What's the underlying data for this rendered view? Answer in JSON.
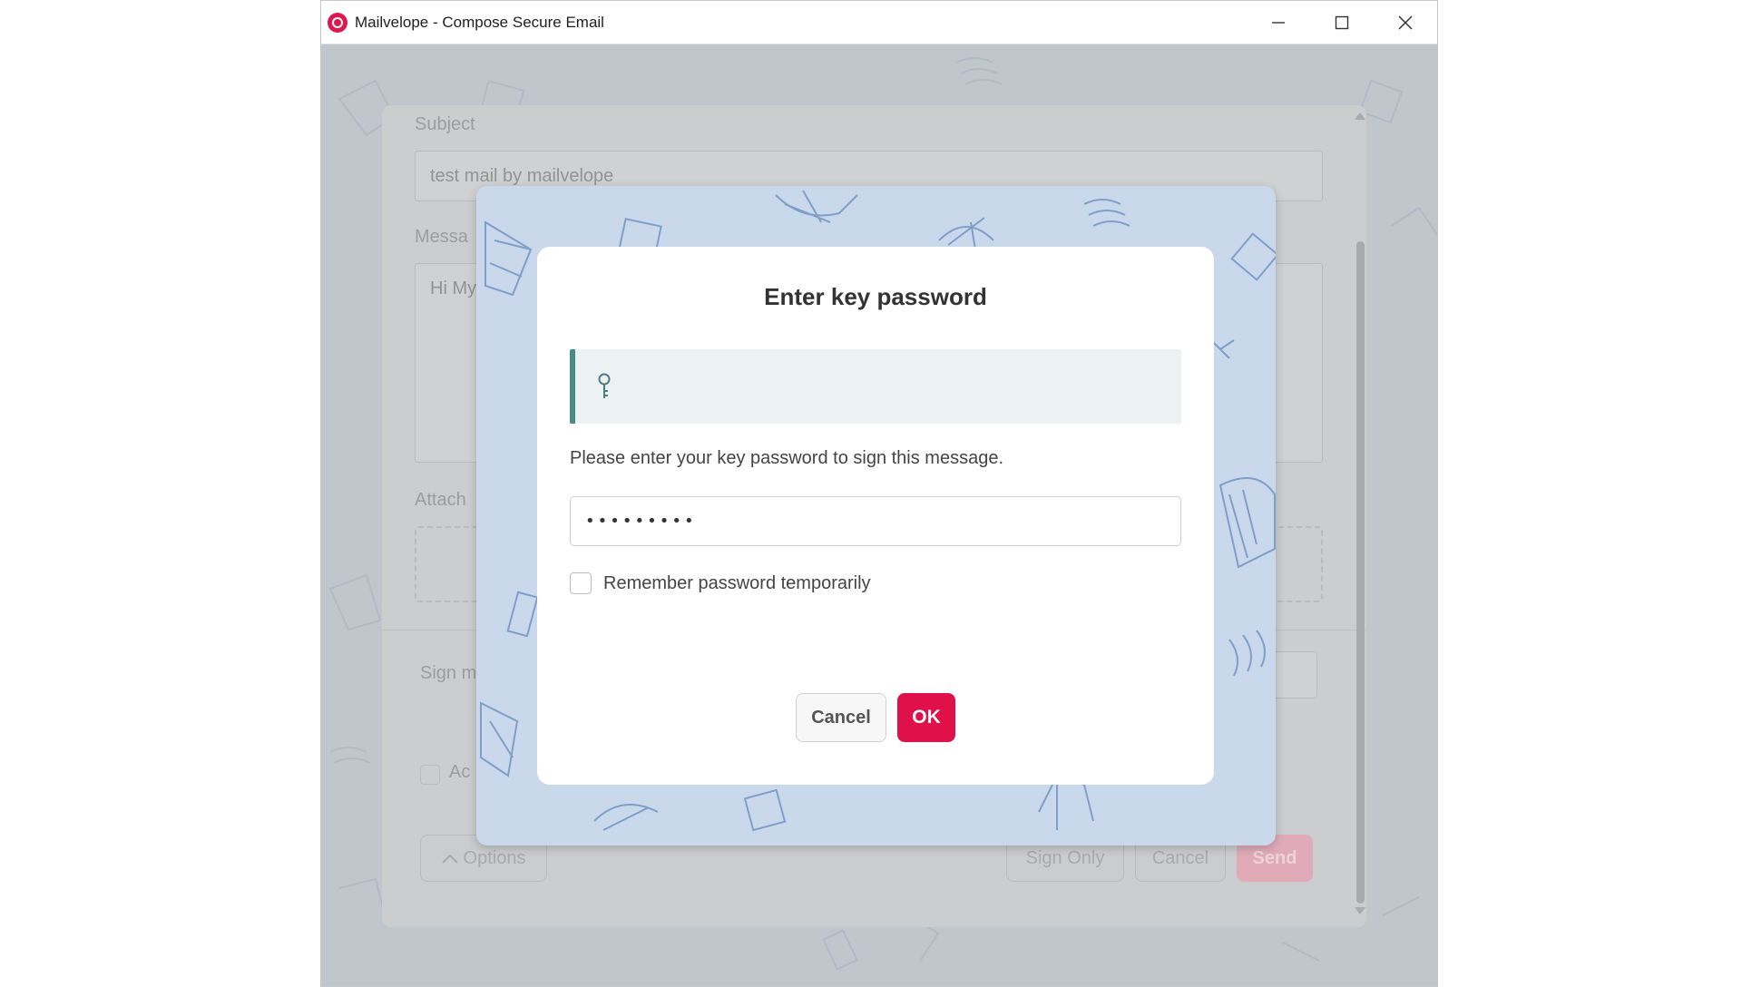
{
  "window": {
    "title": "Mailvelope - Compose Secure Email",
    "controls": [
      "minimize",
      "maximize",
      "close"
    ],
    "logo_icon": "mailvelope-logo-icon"
  },
  "compose": {
    "subject_label": "Subject",
    "subject_value": "test mail by mailvelope",
    "message_label": "Messa",
    "message_value": "Hi My",
    "attachments_label": "Attach",
    "sign_label": "Sign m",
    "checkbox_label": "Ac",
    "options_label": "Options",
    "sign_only_label": "Sign Only",
    "cancel_label": "Cancel",
    "send_label": "Send"
  },
  "dialog": {
    "title": "Enter key password",
    "key_icon": "key-icon",
    "prompt": "Please enter your key password to sign this message.",
    "password_value": "•••••••••",
    "remember_label": "Remember password temporarily",
    "remember_checked": false,
    "cancel_label": "Cancel",
    "ok_label": "OK"
  },
  "colors": {
    "accent": "#e0104a",
    "key_box_border": "#4c8a86",
    "modal_backdrop": "#c9d8eb"
  }
}
